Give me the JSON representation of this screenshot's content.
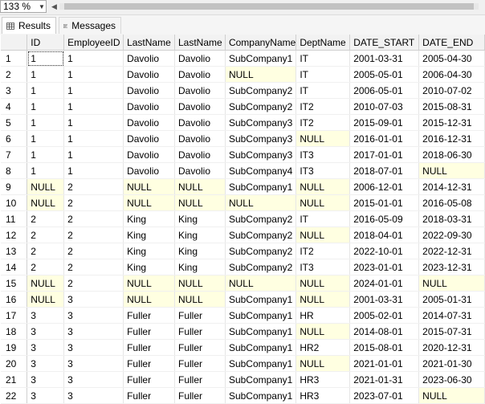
{
  "toolbar": {
    "zoom_value": "133 %"
  },
  "tabs": [
    {
      "label": "Results",
      "icon": "grid-icon"
    },
    {
      "label": "Messages",
      "icon": "messages-icon"
    }
  ],
  "grid": {
    "columns": [
      "ID",
      "EmployeeID",
      "LastName",
      "LastName",
      "CompanyName",
      "DeptName",
      "DATE_START",
      "DATE_END"
    ],
    "null_highlight_color": "#ffffe1",
    "rows": [
      [
        "1",
        "1",
        "Davolio",
        "Davolio",
        "SubCompany1",
        "IT",
        "2001-03-31",
        "2005-04-30"
      ],
      [
        "1",
        "1",
        "Davolio",
        "Davolio",
        "NULL",
        "IT",
        "2005-05-01",
        "2006-04-30"
      ],
      [
        "1",
        "1",
        "Davolio",
        "Davolio",
        "SubCompany2",
        "IT",
        "2006-05-01",
        "2010-07-02"
      ],
      [
        "1",
        "1",
        "Davolio",
        "Davolio",
        "SubCompany2",
        "IT2",
        "2010-07-03",
        "2015-08-31"
      ],
      [
        "1",
        "1",
        "Davolio",
        "Davolio",
        "SubCompany3",
        "IT2",
        "2015-09-01",
        "2015-12-31"
      ],
      [
        "1",
        "1",
        "Davolio",
        "Davolio",
        "SubCompany3",
        "NULL",
        "2016-01-01",
        "2016-12-31"
      ],
      [
        "1",
        "1",
        "Davolio",
        "Davolio",
        "SubCompany3",
        "IT3",
        "2017-01-01",
        "2018-06-30"
      ],
      [
        "1",
        "1",
        "Davolio",
        "Davolio",
        "SubCompany4",
        "IT3",
        "2018-07-01",
        "NULL"
      ],
      [
        "NULL",
        "2",
        "NULL",
        "NULL",
        "SubCompany1",
        "NULL",
        "2006-12-01",
        "2014-12-31"
      ],
      [
        "NULL",
        "2",
        "NULL",
        "NULL",
        "NULL",
        "NULL",
        "2015-01-01",
        "2016-05-08"
      ],
      [
        "2",
        "2",
        "King",
        "King",
        "SubCompany2",
        "IT",
        "2016-05-09",
        "2018-03-31"
      ],
      [
        "2",
        "2",
        "King",
        "King",
        "SubCompany2",
        "NULL",
        "2018-04-01",
        "2022-09-30"
      ],
      [
        "2",
        "2",
        "King",
        "King",
        "SubCompany2",
        "IT2",
        "2022-10-01",
        "2022-12-31"
      ],
      [
        "2",
        "2",
        "King",
        "King",
        "SubCompany2",
        "IT3",
        "2023-01-01",
        "2023-12-31"
      ],
      [
        "NULL",
        "2",
        "NULL",
        "NULL",
        "NULL",
        "NULL",
        "2024-01-01",
        "NULL"
      ],
      [
        "NULL",
        "3",
        "NULL",
        "NULL",
        "SubCompany1",
        "NULL",
        "2001-03-31",
        "2005-01-31"
      ],
      [
        "3",
        "3",
        "Fuller",
        "Fuller",
        "SubCompany1",
        "HR",
        "2005-02-01",
        "2014-07-31"
      ],
      [
        "3",
        "3",
        "Fuller",
        "Fuller",
        "SubCompany1",
        "NULL",
        "2014-08-01",
        "2015-07-31"
      ],
      [
        "3",
        "3",
        "Fuller",
        "Fuller",
        "SubCompany1",
        "HR2",
        "2015-08-01",
        "2020-12-31"
      ],
      [
        "3",
        "3",
        "Fuller",
        "Fuller",
        "SubCompany1",
        "NULL",
        "2021-01-01",
        "2021-01-30"
      ],
      [
        "3",
        "3",
        "Fuller",
        "Fuller",
        "SubCompany1",
        "HR3",
        "2021-01-31",
        "2023-06-30"
      ],
      [
        "3",
        "3",
        "Fuller",
        "Fuller",
        "SubCompany1",
        "HR3",
        "2023-07-01",
        "NULL"
      ]
    ]
  }
}
